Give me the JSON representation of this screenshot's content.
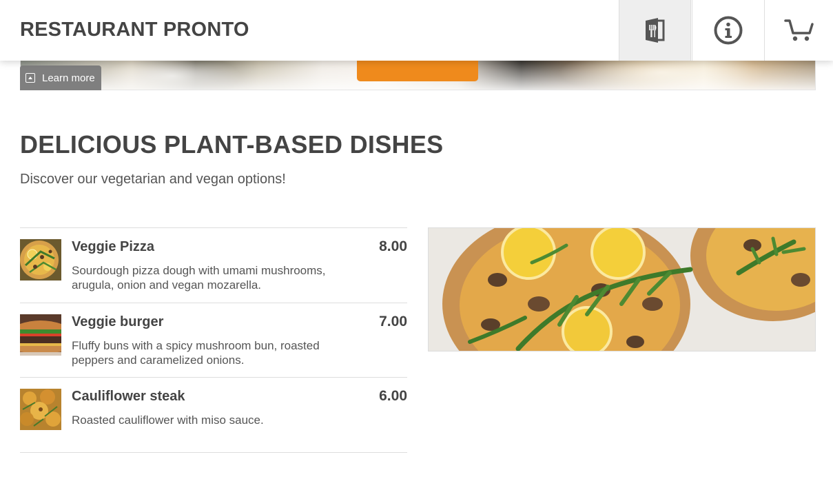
{
  "header": {
    "brand": "RESTAURANT PRONTO",
    "nav": [
      {
        "icon": "menu-book-icon",
        "active": true
      },
      {
        "icon": "info-icon",
        "active": false
      },
      {
        "icon": "cart-icon",
        "active": false
      }
    ]
  },
  "hero": {
    "learn_more_label": "Learn more",
    "cta_color": "#ef8a1c"
  },
  "section": {
    "title": "DELICIOUS PLANT-BASED DISHES",
    "subtitle": "Discover our vegetarian and vegan options!"
  },
  "items": [
    {
      "name": "Veggie Pizza",
      "price": "8.00",
      "description": "Sourdough pizza dough with umami mushrooms, arugula, onion and vegan mozarella.",
      "image": "pizza-thumbnail"
    },
    {
      "name": "Veggie burger",
      "price": "7.00",
      "description": "Fluffy buns with a spicy mushroom bun, roasted peppers and caramelized onions.",
      "image": "burger-thumbnail"
    },
    {
      "name": "Cauliflower steak",
      "price": "6.00",
      "description": "Roasted cauliflower with miso sauce.",
      "image": "cauliflower-thumbnail"
    }
  ],
  "feature_image": "veggie-pizza-photo",
  "colors": {
    "accent": "#ef8a1c",
    "text": "#444444",
    "active_nav_bg": "#eeeeee"
  }
}
